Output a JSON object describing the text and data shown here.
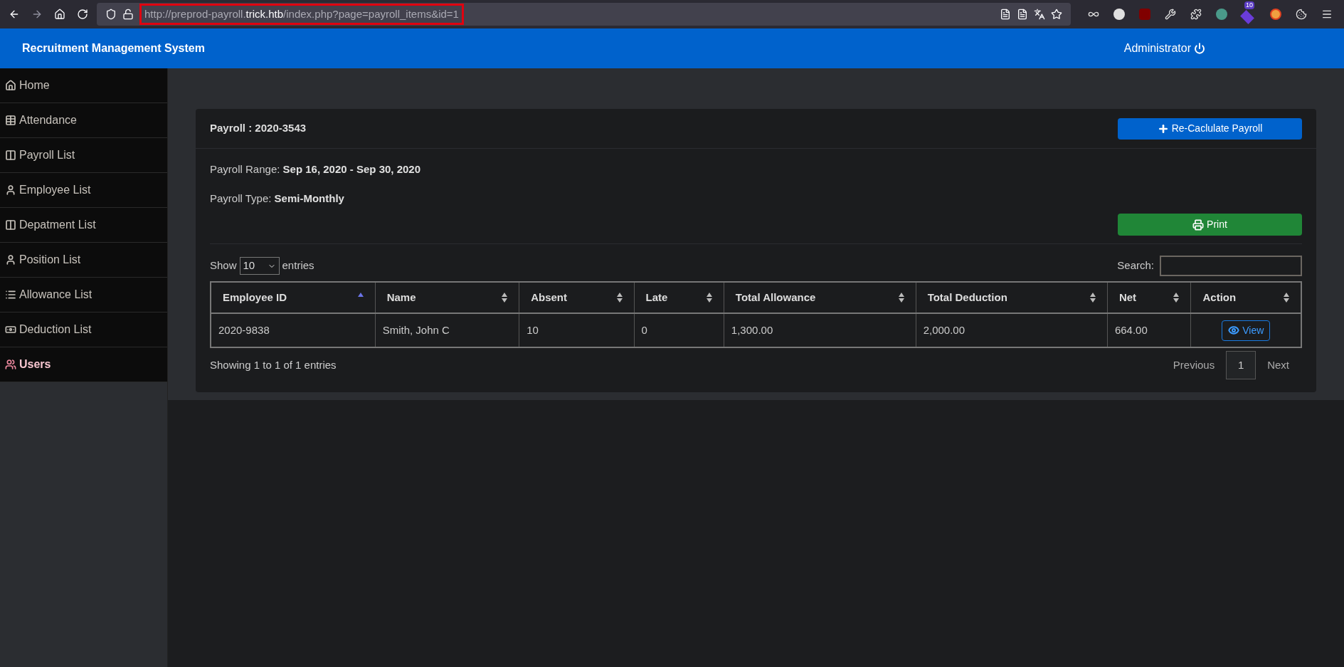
{
  "browser": {
    "url_prefix": "http://preprod-payroll.",
    "url_host": "trick.htb",
    "url_path": "/index.php?page=payroll_items&id=1",
    "extension_badge": "10"
  },
  "app": {
    "title": "Recruitment Management System",
    "user": "Administrator"
  },
  "sidebar": {
    "items": [
      {
        "label": "Home",
        "selected": false
      },
      {
        "label": "Attendance",
        "selected": false
      },
      {
        "label": "Payroll List",
        "selected": false
      },
      {
        "label": "Employee List",
        "selected": false
      },
      {
        "label": "Depatment List",
        "selected": false
      },
      {
        "label": "Position List",
        "selected": false
      },
      {
        "label": "Allowance List",
        "selected": false
      },
      {
        "label": "Deduction List",
        "selected": false
      },
      {
        "label": "Users",
        "selected": true
      }
    ]
  },
  "card": {
    "title": "Payroll : 2020-3543",
    "recalc_button": "Re-Caclulate Payroll",
    "range_label": "Payroll Range:",
    "range_value": "Sep 16, 2020 - Sep 30, 2020",
    "type_label": "Payroll Type:",
    "type_value": "Semi-Monthly",
    "print_button": "Print",
    "show_label": "Show",
    "page_size": "10",
    "entries_label": "entries",
    "search_label": "Search:",
    "table": {
      "columns": [
        {
          "label": "Employee ID",
          "sorted": true
        },
        {
          "label": "Name",
          "sorted": false
        },
        {
          "label": "Absent",
          "sorted": false
        },
        {
          "label": "Late",
          "sorted": false
        },
        {
          "label": "Total Allowance",
          "sorted": false
        },
        {
          "label": "Total Deduction",
          "sorted": false
        },
        {
          "label": "Net",
          "sorted": false
        },
        {
          "label": "Action",
          "sorted": false
        }
      ],
      "rows": [
        {
          "cells": [
            "2020-9838",
            "Smith, John C",
            "10",
            "0",
            "1,300.00",
            "2,000.00",
            "664.00"
          ],
          "action": "View"
        }
      ]
    },
    "info": "Showing 1 to 1 of 1 entries",
    "pagination": {
      "previous": "Previous",
      "pages": [
        {
          "label": "1",
          "selected": true
        }
      ],
      "next": "Next"
    }
  }
}
